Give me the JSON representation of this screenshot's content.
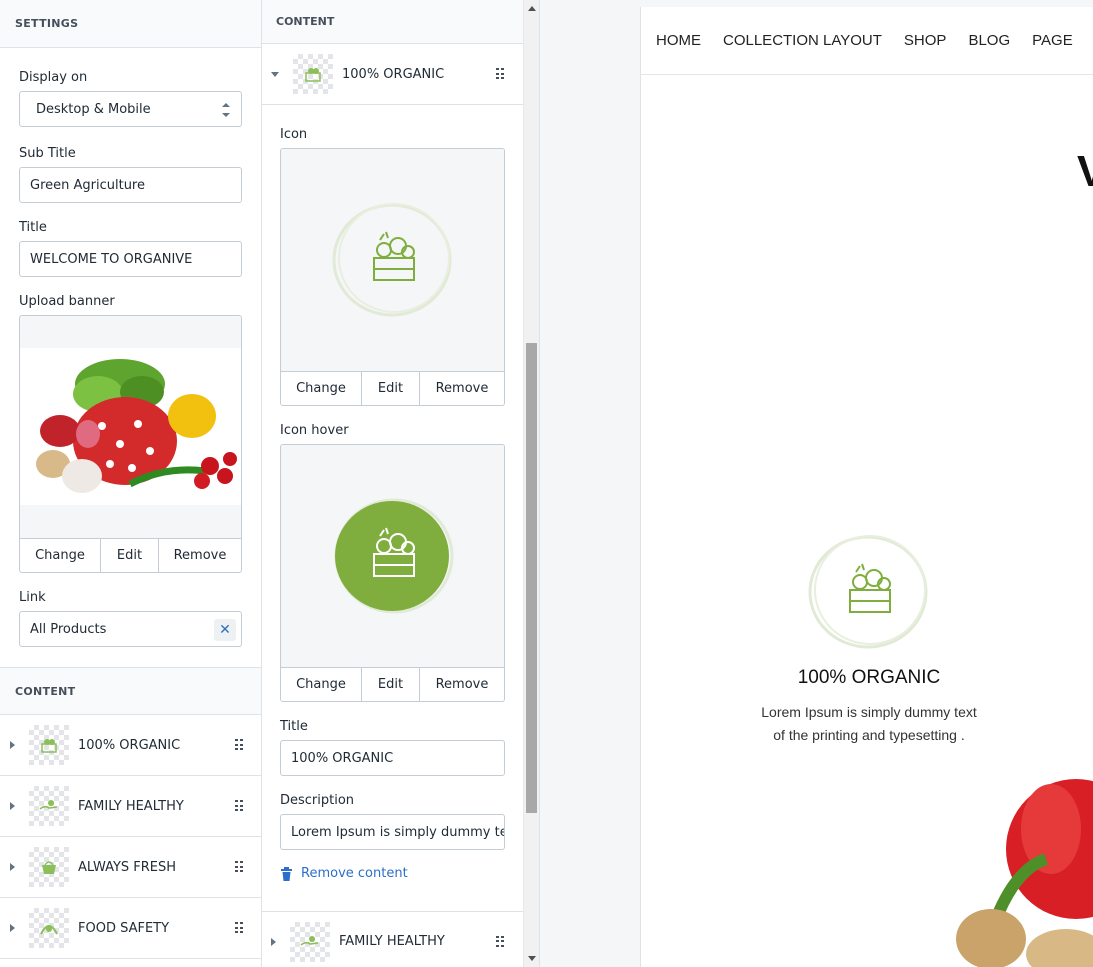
{
  "settings": {
    "heading": "SETTINGS",
    "display_on": {
      "label": "Display on",
      "value": "Desktop & Mobile"
    },
    "sub_title": {
      "label": "Sub Title",
      "value": "Green Agriculture"
    },
    "title": {
      "label": "Title",
      "value": "WELCOME TO ORGANIVE"
    },
    "upload_banner": {
      "label": "Upload banner",
      "change": "Change",
      "edit": "Edit",
      "remove": "Remove"
    },
    "link": {
      "label": "Link",
      "value": "All Products"
    }
  },
  "content": {
    "heading": "CONTENT",
    "items": [
      {
        "label": "100% ORGANIC",
        "icon": "vegetable-crate-icon"
      },
      {
        "label": "FAMILY HEALTHY",
        "icon": "hand-leaf-icon"
      },
      {
        "label": "ALWAYS FRESH",
        "icon": "basket-icon"
      },
      {
        "label": "FOOD SAFETY",
        "icon": "shield-leaf-icon"
      }
    ]
  },
  "editor": {
    "heading": "CONTENT",
    "item_label": "100% ORGANIC",
    "icon_label": "Icon",
    "icon_hover_label": "Icon hover",
    "change": "Change",
    "edit": "Edit",
    "remove": "Remove",
    "title_label": "Title",
    "title_value": "100% ORGANIC",
    "description_label": "Description",
    "description_value": "Lorem Ipsum is simply dummy te",
    "remove_content": "Remove content",
    "next_item_label": "FAMILY HEALTHY",
    "accent_color": "#7fae3e"
  },
  "preview": {
    "nav": [
      "HOME",
      "COLLECTION LAYOUT",
      "SHOP",
      "BLOG",
      "PAGE"
    ],
    "heading_fragment": "V",
    "feature_title": "100% ORGANIC",
    "feature_desc": "Lorem Ipsum is simply dummy text of the printing and typesetting ."
  }
}
